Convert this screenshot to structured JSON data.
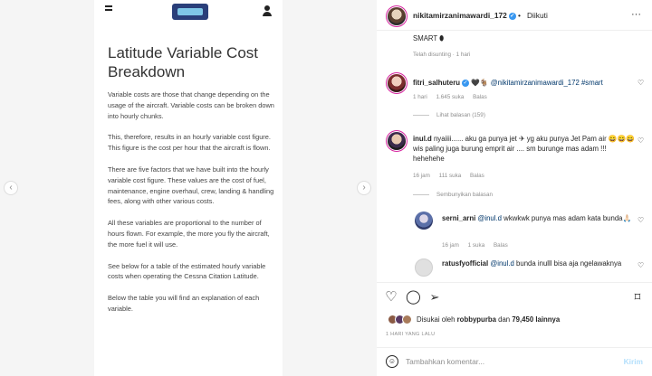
{
  "article": {
    "title": "Latitude Variable Cost Breakdown",
    "paragraphs": [
      "Variable costs are those that change depending on the usage of the aircraft. Variable costs can be broken down into hourly chunks.",
      "This, therefore, results in an hourly variable cost figure. This figure is the cost per hour that the aircraft is flown.",
      "There are five factors that we have built into the hourly variable cost figure. These values are the cost of fuel, maintenance, engine overhaul, crew, landing & handling fees, along with other various costs.",
      "All these variables are proportional to the number of hours flown. For example, the more you fly the aircraft, the more fuel it will use.",
      "See below for a table of the estimated hourly variable costs when operating the Cessna Citation Latitude.",
      "Below the table you will find an explanation of each variable."
    ]
  },
  "post": {
    "author": "nikitamirzanimawardi_172",
    "follow_status": "Diikuti",
    "dot": "•",
    "more": "···",
    "caption_tail": "SMART ⬮",
    "caption_meta": "Telah disunting · 1 hari"
  },
  "comments": [
    {
      "user": "fitri_salhuteru",
      "text": " 🖤🐐 @nikitamirzanimawardi_172 #smart",
      "meta": [
        "1 hari",
        "1.645 suka",
        "Balas"
      ],
      "replies": "Lihat balasan (159)"
    },
    {
      "user": "inul.d",
      "text": " nyaiiii...... aku ga punya jet ✈ yg aku punya Jet Pam air 😄😄😄 wis paling juga burung emprit air .... sm burunge mas adam !!! hehehehe",
      "meta": [
        "16 jam",
        "111 suka",
        "Balas"
      ],
      "replies": "Sembunyikan balasan"
    },
    {
      "user": "serni_arni",
      "mention": "@inul.d",
      "text": " wkwkwk punya mas adam kata bunda🙏🏻",
      "meta": [
        "16 jam",
        "1 suka",
        "Balas"
      ]
    },
    {
      "user": "ratusfyofficial",
      "mention": "@inul.d",
      "text": " bunda inulll bisa aja ngelawaknya"
    }
  ],
  "actions": {
    "liked_prefix": "Disukai oleh ",
    "liked_user": "robbypurba",
    "liked_mid": " dan ",
    "liked_count": "79,450 lainnya",
    "time_ago": "1 HARI YANG LALU"
  },
  "composer": {
    "placeholder": "Tambahkan komentar...",
    "send_label": "Kirim"
  },
  "colors": {
    "accent": "#3897f0",
    "link": "#00376b",
    "muted": "#8e8e8e",
    "send_disabled": "#b2dffc"
  }
}
